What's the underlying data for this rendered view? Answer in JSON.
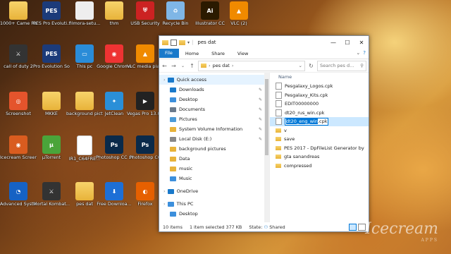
{
  "desktop": {
    "icons": [
      {
        "label": "1000+ Came Raw Presets...",
        "icon": "folder-icon"
      },
      {
        "label": "PES Pro Evoluti...",
        "icon": "pes-icon"
      },
      {
        "label": "filmora-setu...",
        "icon": "filmora-icon"
      },
      {
        "label": "thm",
        "icon": "folder-icon"
      },
      {
        "label": "USB Security",
        "icon": "shield-icon"
      },
      {
        "label": "Recycle Bin",
        "icon": "recycle-bin-icon"
      },
      {
        "label": "Illustrator CC",
        "icon": "illustrator-icon"
      },
      {
        "label": "VLC (2)",
        "icon": "vlc-icon"
      },
      {
        "label": "call of duty 2",
        "icon": "game-icon"
      },
      {
        "label": "Pro Evolution Soccer 2017",
        "icon": "pes-icon"
      },
      {
        "label": "This pc",
        "icon": "this-pc-icon"
      },
      {
        "label": "Google Chrome",
        "icon": "chrome-icon"
      },
      {
        "label": "VLC media player",
        "icon": "vlc-icon"
      },
      {
        "label": "Screenshot",
        "icon": "screenshot-icon"
      },
      {
        "label": "MKKE",
        "icon": "folder-icon"
      },
      {
        "label": "background pictures",
        "icon": "folder-icon"
      },
      {
        "label": "JetClean",
        "icon": "jetclean-icon"
      },
      {
        "label": "Vegas Pro 13.0 (64-bit)",
        "icon": "vegas-icon"
      },
      {
        "label": "Icecream Screen ...",
        "icon": "icecream-icon"
      },
      {
        "label": "µTorrent",
        "icon": "utorrent-icon"
      },
      {
        "label": "IR1_C64FRE...",
        "icon": "document-icon"
      },
      {
        "label": "Photoshop CC x64",
        "icon": "photoshop-icon"
      },
      {
        "label": "Photoshop CC",
        "icon": "photoshop-icon"
      },
      {
        "label": "Advanced SystemCare",
        "icon": "systemcare-icon"
      },
      {
        "label": "Mortal Kombat...",
        "icon": "game-icon"
      },
      {
        "label": "pes dat",
        "icon": "folder-icon"
      },
      {
        "label": "Free Downloa...",
        "icon": "download-icon"
      },
      {
        "label": "Firefox",
        "icon": "firefox-icon"
      }
    ]
  },
  "explorer": {
    "title": "pes dat",
    "tabs": [
      "File",
      "Home",
      "Share",
      "View"
    ],
    "address": {
      "root": "pes dat"
    },
    "search_placeholder": "Search pes d...",
    "nav_pane": [
      {
        "label": "Quick access",
        "icon": "star-icon",
        "top": true,
        "pinned": false
      },
      {
        "label": "Downloads",
        "icon": "download-icon",
        "top": false,
        "pinned": true
      },
      {
        "label": "Desktop",
        "icon": "desktop-icon",
        "top": false,
        "pinned": true
      },
      {
        "label": "Documents",
        "icon": "documents-icon",
        "top": false,
        "pinned": true
      },
      {
        "label": "Pictures",
        "icon": "pictures-icon",
        "top": false,
        "pinned": true
      },
      {
        "label": "System Volume Information",
        "icon": "folder-icon",
        "top": false,
        "pinned": true
      },
      {
        "label": "Local Disk (E:)",
        "icon": "drive-icon",
        "top": false,
        "pinned": true
      },
      {
        "label": "background pictures",
        "icon": "folder-icon",
        "top": false,
        "pinned": false
      },
      {
        "label": "Data",
        "icon": "folder-icon",
        "top": false,
        "pinned": false
      },
      {
        "label": "music",
        "icon": "folder-icon",
        "top": false,
        "pinned": false
      },
      {
        "label": "Music",
        "icon": "music-icon",
        "top": false,
        "pinned": false
      },
      {
        "label": "OneDrive",
        "icon": "onedrive-icon",
        "top": true,
        "pinned": false
      },
      {
        "label": "This PC",
        "icon": "this-pc-icon",
        "top": true,
        "pinned": false
      },
      {
        "label": "Desktop",
        "icon": "desktop-icon",
        "top": false,
        "pinned": false
      }
    ],
    "column_name": "Name",
    "files": [
      {
        "name": "Pesgalaxy_Logos.cpk",
        "type": "doc"
      },
      {
        "name": "Pesgalaxy_Kits.cpk",
        "type": "doc"
      },
      {
        "name": "EDIT00000000",
        "type": "doc"
      },
      {
        "name": "dt20_rus_win.cpk",
        "type": "doc"
      },
      {
        "name": "v",
        "type": "folder"
      },
      {
        "name": "save",
        "type": "folder"
      },
      {
        "name": "PES 2017 - DpFileList Generator by",
        "type": "folder"
      },
      {
        "name": "gta sanandreas",
        "type": "folder"
      },
      {
        "name": "compressed",
        "type": "folder"
      }
    ],
    "rename": {
      "highlighted": "dt20_eng_win",
      "rest": ".cpk"
    },
    "status": {
      "count": "10 items",
      "selected": "1 item selected  377 KB",
      "state_label": "State:",
      "state_value": "Shared"
    }
  },
  "watermark": {
    "brand": "Icecream",
    "sub": "APPS"
  }
}
